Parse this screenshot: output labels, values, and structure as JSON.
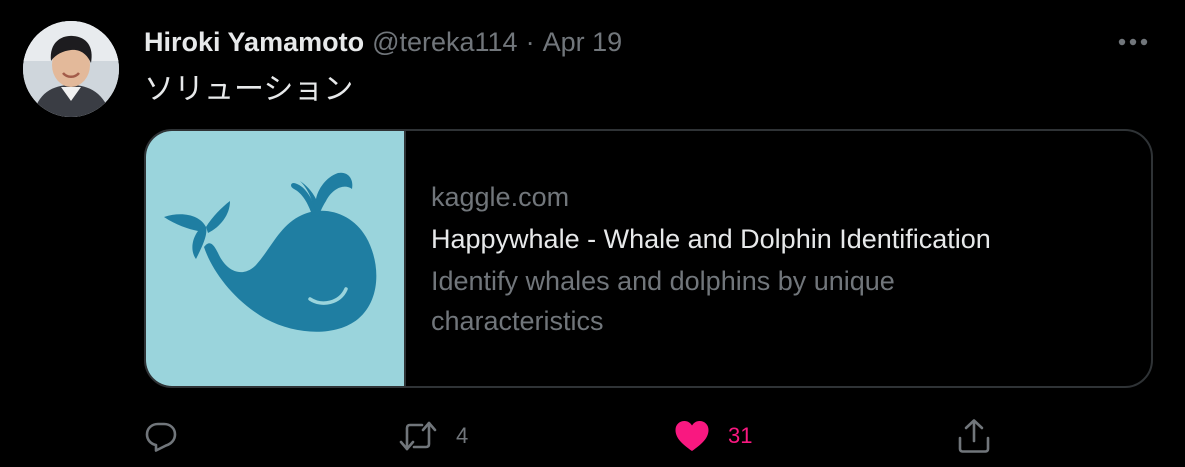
{
  "tweet": {
    "display_name": "Hiroki Yamamoto",
    "handle": "@tereka114",
    "separator": "·",
    "date": "Apr 19",
    "text": "ソリューション"
  },
  "card": {
    "domain": "kaggle.com",
    "title": "Happywhale - Whale and Dolphin Identification",
    "description": "Identify whales and dolphins by unique characteristics",
    "thumbnail_icon": "whale-logo",
    "thumbnail_bg": "#9ad4dc",
    "whale_color": "#1f7ea2"
  },
  "actions": {
    "reply": {
      "icon": "reply-icon"
    },
    "retweet": {
      "icon": "retweet-icon",
      "count": "4"
    },
    "like": {
      "icon": "heart-icon",
      "count": "31",
      "liked": true,
      "color": "#f91880"
    },
    "share": {
      "icon": "share-icon"
    }
  },
  "colors": {
    "background": "#000000",
    "text_primary": "#e7e9ea",
    "text_secondary": "#71767b",
    "border": "#2f3336",
    "like": "#f91880"
  }
}
